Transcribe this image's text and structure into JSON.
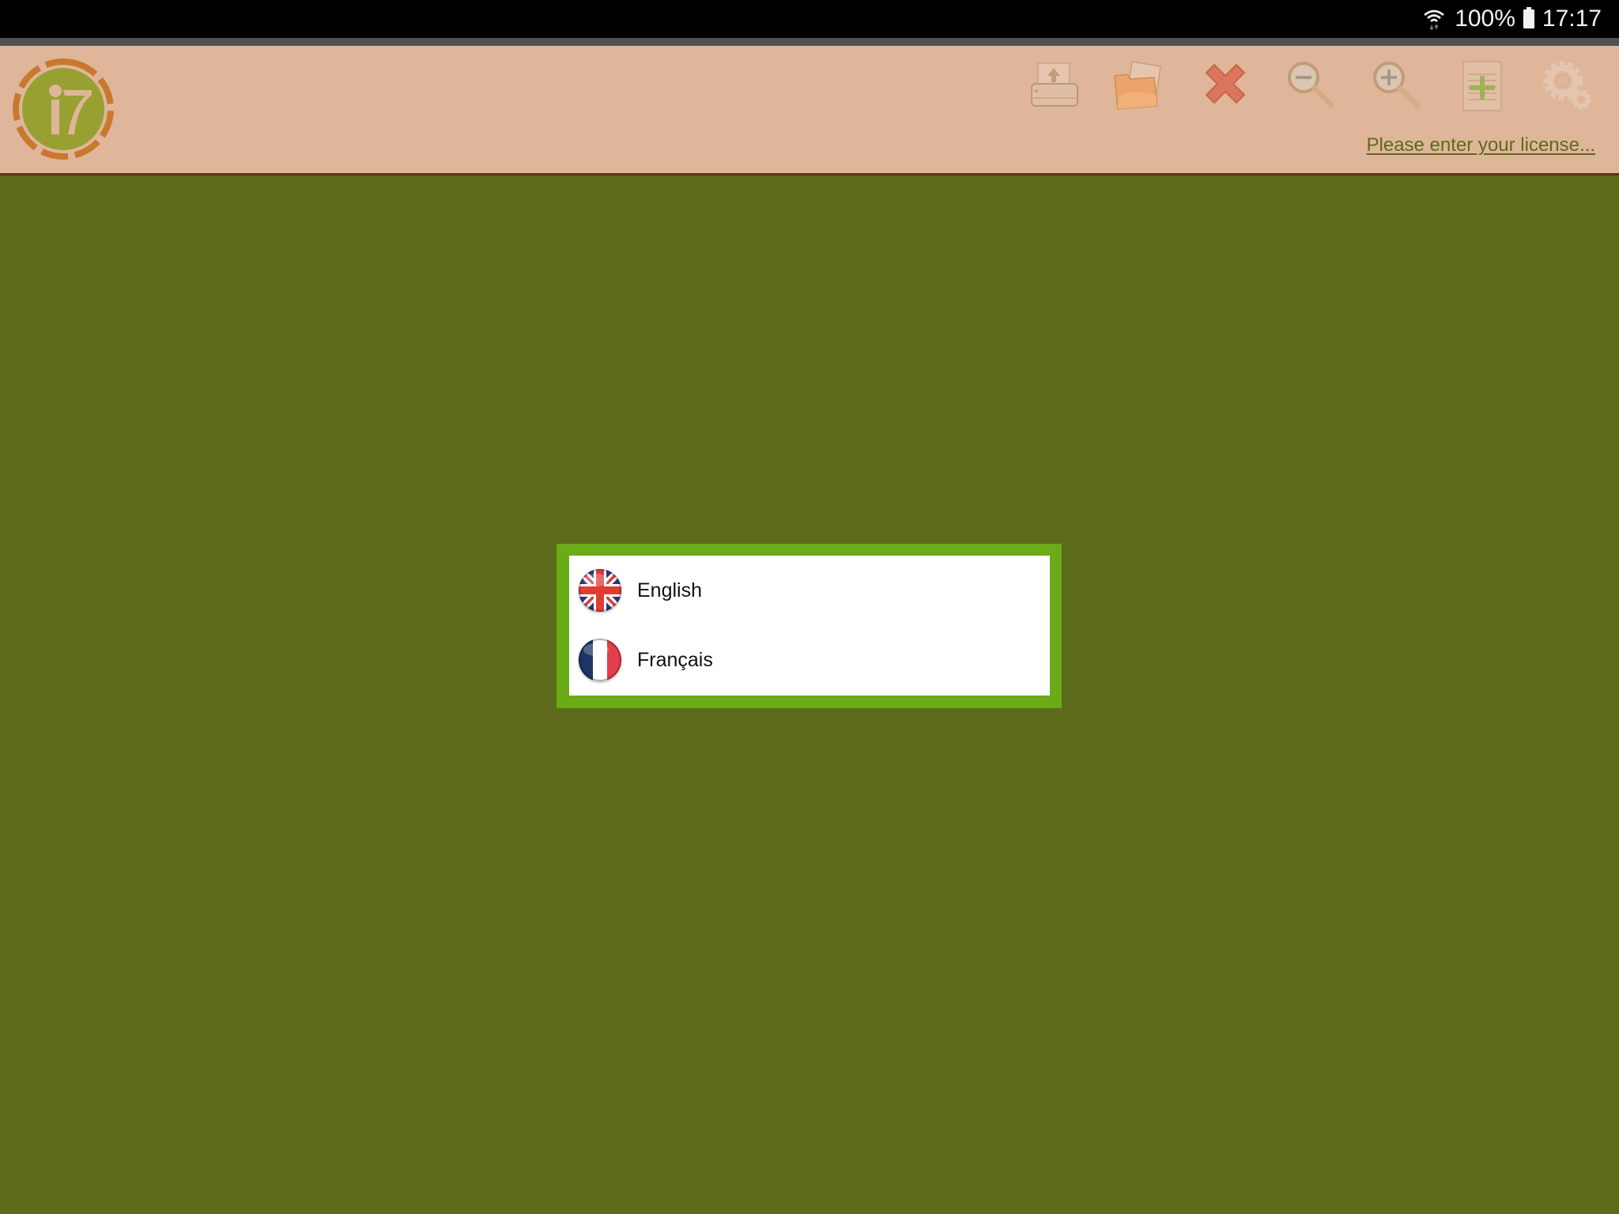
{
  "status_bar": {
    "wifi_icon": "wifi-icon",
    "battery_percent": "100%",
    "battery_icon": "battery-full-icon",
    "time": "17:17"
  },
  "header": {
    "logo": {
      "text_i": "i",
      "text_7": "7",
      "icon": "i7-logo"
    },
    "toolbar": [
      {
        "name": "print-button",
        "icon": "printer-icon",
        "enabled": false
      },
      {
        "name": "open-button",
        "icon": "folder-open-icon",
        "enabled": false
      },
      {
        "name": "close-button",
        "icon": "red-x-icon",
        "enabled": false
      },
      {
        "name": "zoom-out-button",
        "icon": "zoom-out-icon",
        "enabled": false
      },
      {
        "name": "zoom-in-button",
        "icon": "zoom-in-icon",
        "enabled": false
      },
      {
        "name": "add-document-button",
        "icon": "document-add-icon",
        "enabled": false
      },
      {
        "name": "settings-button",
        "icon": "gears-icon",
        "enabled": false
      }
    ],
    "license_link": "Please enter your license..."
  },
  "language_dialog": {
    "items": [
      {
        "label": "English",
        "flag": "uk-flag-icon"
      },
      {
        "label": "Français",
        "flag": "france-flag-icon"
      }
    ]
  },
  "colors": {
    "background": "#5d6a1a",
    "header": "#dfb699",
    "dialog_border": "#6aab17",
    "link": "#5e6a1c"
  }
}
